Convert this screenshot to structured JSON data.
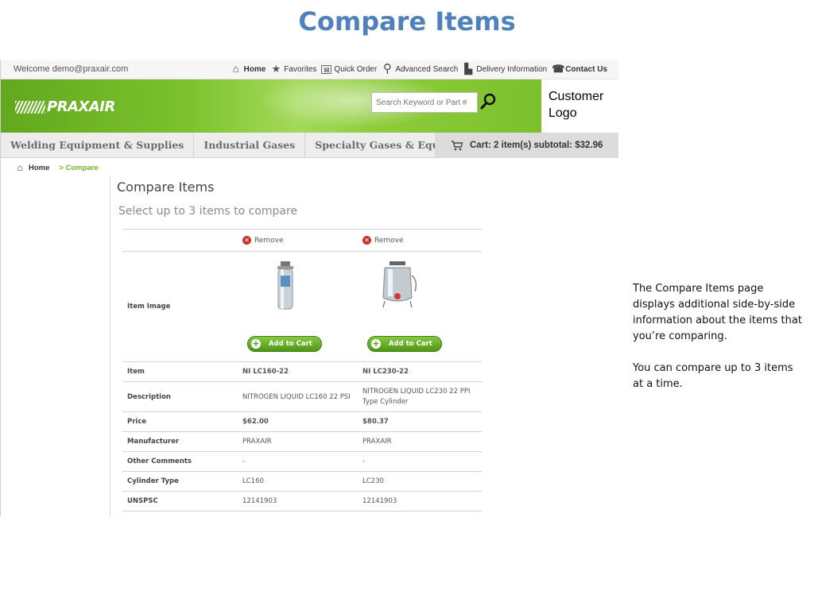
{
  "slide": {
    "title": "Compare Items",
    "note_paragraphs": [
      "The Compare Items page displays additional side-by-side information about the items that you’re comparing.",
      "You can compare up to 3 items at a time."
    ]
  },
  "utility_bar": {
    "welcome": "Welcome demo@praxair.com",
    "links": [
      "Home",
      "Favorites",
      "Quick Order",
      "Advanced Search",
      "Delivery Information",
      "Contact Us"
    ]
  },
  "header": {
    "brand": "PRAXAIR",
    "search_placeholder": "Search Keyword or Part #",
    "customer_logo_line1": "Customer",
    "customer_logo_line2": "Logo",
    "brand_color": "#74bb26"
  },
  "category_nav": {
    "items": [
      "Welding Equipment & Supplies",
      "Industrial Gases",
      "Specialty Gases & Equipment"
    ],
    "cart_text": "Cart: 2 item(s) subtotal: $32.96"
  },
  "breadcrumb": {
    "home": "Home",
    "current": "> Compare"
  },
  "compare": {
    "title": "Compare Items",
    "subtitle": "Select up to 3 items to compare",
    "remove_label": "Remove",
    "image_label": "Item Image",
    "add_to_cart_label": "Add to Cart",
    "rows": [
      {
        "label": "Item",
        "values": [
          "NI LC160-22",
          "NI LC230-22"
        ]
      },
      {
        "label": "Description",
        "values": [
          "NITROGEN LIQUID LC160 22 PSI",
          "NITROGEN LIQUID LC230 22 PPI Type Cylinder"
        ]
      },
      {
        "label": "Price",
        "values": [
          "$62.00",
          "$80.37"
        ]
      },
      {
        "label": "Manufacturer",
        "values": [
          "PRAXAIR",
          "PRAXAIR"
        ]
      },
      {
        "label": "Other Comments",
        "values": [
          "-",
          "-"
        ]
      },
      {
        "label": "Cylinder Type",
        "values": [
          "LC160",
          "LC230"
        ]
      },
      {
        "label": "UNSPSC",
        "values": [
          "12141903",
          "12141903"
        ]
      }
    ]
  }
}
